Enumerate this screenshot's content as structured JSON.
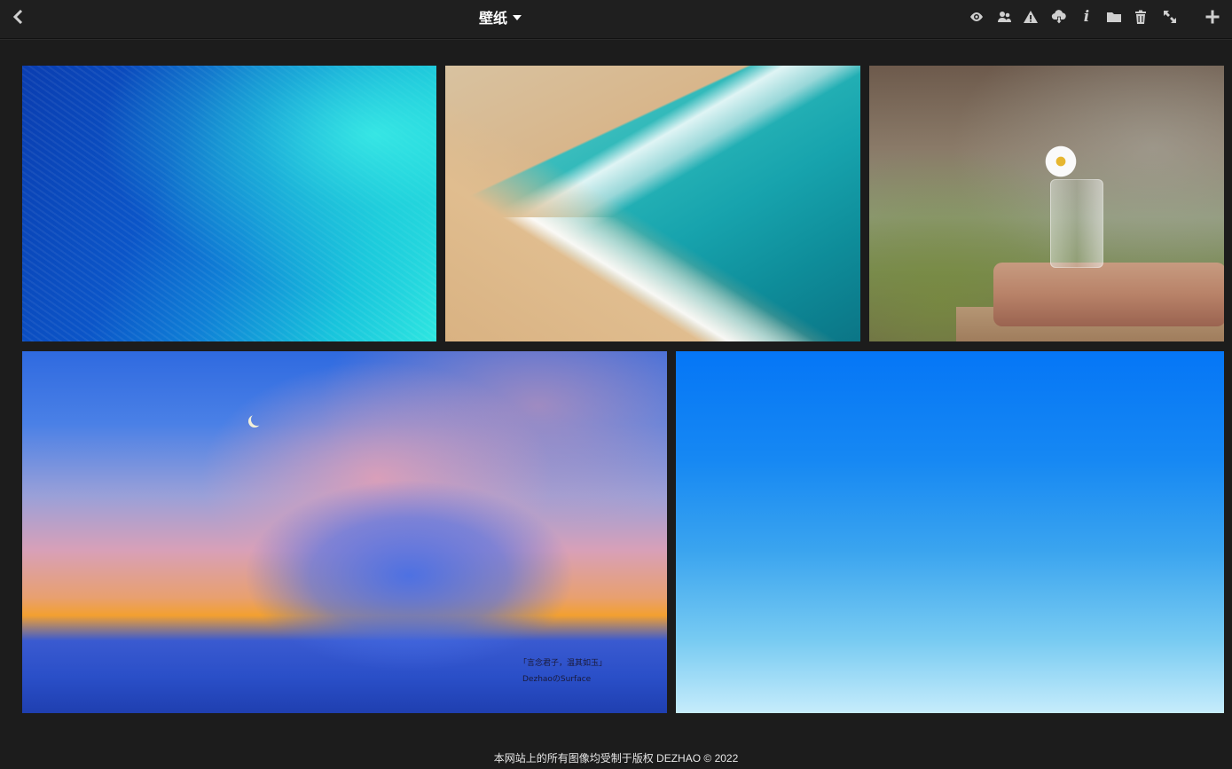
{
  "header": {
    "title": "壁纸"
  },
  "toolbar": {
    "icons": [
      "back-icon",
      "eye-icon",
      "share-users-icon",
      "warning-icon",
      "cloud-download-icon",
      "info-icon",
      "folder-icon",
      "trash-icon",
      "fullscreen-icon",
      "plus-icon"
    ],
    "info_glyph": "i"
  },
  "photos": [
    {
      "subject": "aerial-ocean"
    },
    {
      "subject": "aerial-beach-waves"
    },
    {
      "subject": "flower-in-jar-on-books"
    },
    {
      "subject": "painted-sky-clouds"
    },
    {
      "subject": "blue-gradient-sky"
    }
  ],
  "photo4_caption": {
    "line1": "「言念君子，温其如玉」",
    "line2": "DezhaoのSurface"
  },
  "footer": {
    "text": "本网站上的所有图像均受制于版权 DEZHAO © 2022"
  },
  "colors": {
    "background": "#1c1c1c",
    "topbar": "#1f1f1f",
    "icon": "#cfcfcf"
  }
}
